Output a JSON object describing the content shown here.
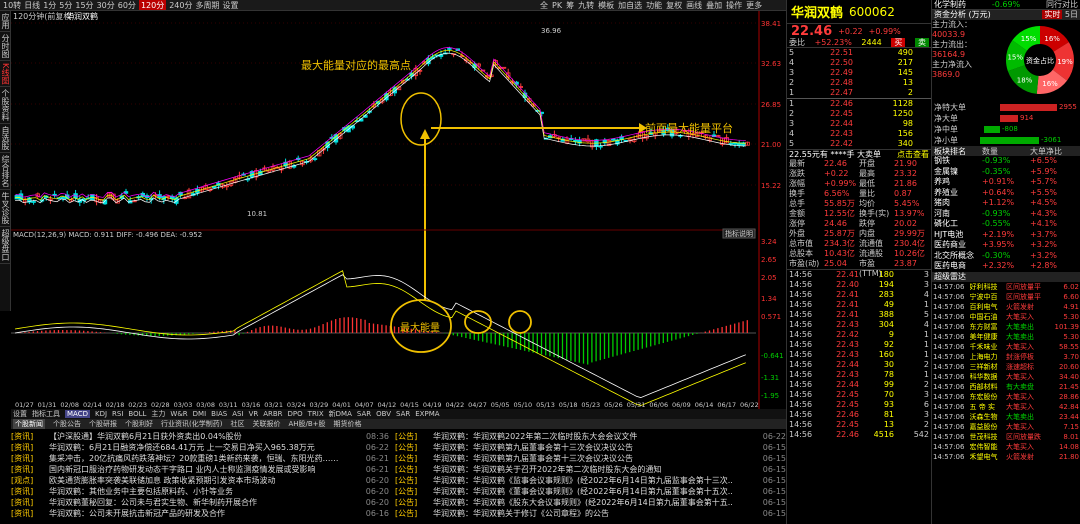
{
  "toolbar": {
    "items": [
      "10转",
      "日线",
      "1分",
      "5分",
      "15分",
      "30分",
      "60分",
      "120分",
      "240分",
      "多周期",
      "设置"
    ],
    "active": "120分",
    "tools": [
      "全",
      "PK",
      "筹",
      "九转",
      "模板",
      "加自选",
      "功能",
      "复权",
      "画线",
      "叠加",
      "操作",
      "更多"
    ]
  },
  "left_rail": [
    "应用",
    "分时图",
    "K线图",
    "个股资料",
    "自选股",
    "综合排名",
    "牛叉诊股",
    "超级盘口"
  ],
  "chart": {
    "header_period": "120分钟(前复权)",
    "header_name": "华润双鹤",
    "price_axis": [
      "38.41",
      "32.63",
      "26.85",
      "21.00",
      "15.22"
    ],
    "price_labels": {
      "high": "36.96",
      "low": "10.81"
    },
    "annotation_top": "最大能量对应的最高点",
    "annotation_right": "前面最大能量平台",
    "annotation_energy": "最大能量",
    "macd_header": "MACD(12,26,9)  MACD: 0.911  DIFF: -0.496  DEA: -0.952",
    "macd_axis": [
      "3.24",
      "2.65",
      "2.05",
      "1.34",
      "0.571",
      "-0.641",
      "-1.31",
      "-1.95"
    ],
    "help_label": "指标说明",
    "x_axis": [
      "01/27",
      "01/31",
      "02/08",
      "02/14",
      "02/18",
      "02/23",
      "02/28",
      "03/03",
      "03/08",
      "03/11",
      "03/16",
      "03/21",
      "03/24",
      "03/29",
      "04/01",
      "04/07",
      "04/12",
      "04/15",
      "04/19",
      "04/22",
      "04/27",
      "05/05",
      "05/10",
      "05/13",
      "05/18",
      "05/23",
      "05/26",
      "05/31",
      "06/06",
      "06/09",
      "06/14",
      "06/17",
      "06/22"
    ]
  },
  "indicators": [
    "设置",
    "指标工具",
    "MACD",
    "KDJ",
    "RSI",
    "BOLL",
    "主力",
    "W&R",
    "DMI",
    "BIAS",
    "ASI",
    "VR",
    "ARBR",
    "DPO",
    "TRIX",
    "新DMA",
    "SAR",
    "OBV",
    "SAR",
    "EXPMA"
  ],
  "indicator_active": "MACD",
  "news_tabs": [
    "个股新闻",
    "个股公告",
    "个股研报",
    "个股利好",
    "行业资讯(化学制药)",
    "社区",
    "关联报价",
    "AH股/B+股",
    "期货价格"
  ],
  "news_left": [
    {
      "cat": "资讯",
      "title": "【沪深股通】华润双鹤6月21日获外资卖出0.04%股份",
      "date": "08:36"
    },
    {
      "cat": "资讯",
      "title": "华润双鹤：6月21日融资净偿还684.41万元 上一交易日净买入965.38万元",
      "date": "06-22"
    },
    {
      "cat": "资讯",
      "title": "集采冲击，20亿抗痛风药跌落神坛？20款重磅1类新药来袭，恒瑞、东阳光药……",
      "date": "06-21"
    },
    {
      "cat": "资讯",
      "title": "国内新冠口服治疗药物研发动态干字路口 业内人士称监测疫情发展或受影响",
      "date": "06-21"
    },
    {
      "cat": "观点",
      "title": "欧美通货膨胀率突袭美联储加息 政策收紧预期引发资本市场波动",
      "date": "06-20"
    },
    {
      "cat": "资讯",
      "title": "华润双鹤：其他业务中主要包括原料药、小针等业务",
      "date": "06-20"
    },
    {
      "cat": "资讯",
      "title": "华润双鹤董秘回复：公司未与君实生物、新华制药开展合作",
      "date": "06-20"
    },
    {
      "cat": "资讯",
      "title": "华润双鹤：公司未开展抗击新冠产品的研发及合作",
      "date": "06-16"
    }
  ],
  "news_right": [
    {
      "cat": "公告",
      "title": "华润双鹤：华润双鹤2022年第二次临时股东大会会议文件",
      "date": "06-22"
    },
    {
      "cat": "公告",
      "title": "华润双鹤：华润双鹤第九届董事会第十三次会议决议公告",
      "date": "06-15"
    },
    {
      "cat": "公告",
      "title": "华润双鹤：华润双鹤第九届董事会第十三次会议决议公告",
      "date": "06-15"
    },
    {
      "cat": "公告",
      "title": "华润双鹤：华润双鹤关于召开2022年第二次临时股东大会的通知",
      "date": "06-15"
    },
    {
      "cat": "公告",
      "title": "华润双鹤：华润双鹤《监事会议事规则》(经2022年6月14日第九届监事会第十三次..",
      "date": "06-15"
    },
    {
      "cat": "公告",
      "title": "华润双鹤：华润双鹤《董事会议事规则》(经2022年6月14日第九届董事会第十五次..",
      "date": "06-15"
    },
    {
      "cat": "公告",
      "title": "华润双鹤：华润双鹤《股东大会议事规则》(经2022年6月14日第九届董事会第十五..",
      "date": "06-15"
    },
    {
      "cat": "公告",
      "title": "华润双鹤：华润双鹤关于修订《公司章程》的公告",
      "date": "06-15"
    }
  ],
  "quote": {
    "name": "华润双鹤",
    "code": "600062",
    "price": "22.46",
    "change": "+0.22",
    "pct": "+0.99%",
    "weibi_label": "委比",
    "weibi": "+52.23%",
    "weicha": "2444",
    "buy_btn": "买",
    "sell_btn": "卖",
    "asks": [
      {
        "lvl": "5",
        "price": "22.51",
        "vol": "490"
      },
      {
        "lvl": "4",
        "price": "22.50",
        "vol": "217"
      },
      {
        "lvl": "3",
        "price": "22.49",
        "vol": "145"
      },
      {
        "lvl": "2",
        "price": "22.48",
        "vol": "13"
      },
      {
        "lvl": "1",
        "price": "22.47",
        "vol": "2"
      }
    ],
    "bids": [
      {
        "lvl": "1",
        "price": "22.46",
        "vol": "1128"
      },
      {
        "lvl": "2",
        "price": "22.45",
        "vol": "1250"
      },
      {
        "lvl": "3",
        "price": "22.44",
        "vol": "98"
      },
      {
        "lvl": "4",
        "price": "22.43",
        "vol": "156"
      },
      {
        "lvl": "5",
        "price": "22.42",
        "vol": "340"
      }
    ],
    "bigorder": "22.55元有 ****手 大卖单",
    "bigorder_link": "点击查看",
    "stats": [
      [
        "最新",
        "22.46",
        "开盘",
        "21.90"
      ],
      [
        "涨跌",
        "+0.22",
        "最高",
        "23.32"
      ],
      [
        "涨幅",
        "+0.99%",
        "最低",
        "21.86"
      ],
      [
        "换手",
        "6.56%",
        "量比",
        "0.87"
      ],
      [
        "总手",
        "55.85万",
        "均价",
        "5.45%"
      ],
      [
        "金额",
        "12.55亿",
        "换手(实)",
        "13.97%"
      ],
      [
        "涨停",
        "24.46",
        "跌停",
        "20.02"
      ],
      [
        "外盘",
        "25.87万",
        "内盘",
        "29.99万"
      ],
      [
        "总市值",
        "234.3亿",
        "流通值",
        "230.4亿"
      ],
      [
        "总股本",
        "10.43亿",
        "流通股",
        "10.26亿"
      ],
      [
        "市盈(动)",
        "25.04",
        "市盈(TTM)",
        "23.87"
      ]
    ],
    "ticks": [
      [
        "14:56",
        "22.41",
        "180",
        "3"
      ],
      [
        "14:56",
        "22.40",
        "194",
        "3"
      ],
      [
        "14:56",
        "22.41",
        "283",
        "4"
      ],
      [
        "14:56",
        "22.41",
        "49",
        "1"
      ],
      [
        "14:56",
        "22.41",
        "388",
        "5"
      ],
      [
        "14:56",
        "22.43",
        "304",
        "4"
      ],
      [
        "14:56",
        "22.42",
        "9",
        "1"
      ],
      [
        "14:56",
        "22.43",
        "92",
        "1"
      ],
      [
        "14:56",
        "22.43",
        "160",
        "1"
      ],
      [
        "14:56",
        "22.44",
        "30",
        "2"
      ],
      [
        "14:56",
        "22.43",
        "78",
        "1"
      ],
      [
        "14:56",
        "22.44",
        "99",
        "2"
      ],
      [
        "14:56",
        "22.45",
        "70",
        "3"
      ],
      [
        "14:56",
        "22.45",
        "93",
        "6"
      ],
      [
        "14:56",
        "22.46",
        "81",
        "3"
      ],
      [
        "14:56",
        "22.45",
        "13",
        "2"
      ],
      [
        "14:56",
        "22.46",
        "4516",
        "542"
      ]
    ]
  },
  "far_right": {
    "industry": "化学制药",
    "industry_pct": "-0.69%",
    "industry_link": "同行对比",
    "fund_title": "资金分析 (万元)",
    "fund_tabs": [
      "实时",
      "5日"
    ],
    "fund": [
      {
        "label": "主力流入：",
        "val": "40033.9"
      },
      {
        "label": "主力流出：",
        "val": "36164.9"
      },
      {
        "label": "主力净流入",
        "val": "3869.0"
      }
    ],
    "pie_center": "资金占比",
    "pie_labels": [
      "16%",
      "19%",
      "16%",
      "18%",
      "15%",
      "15%"
    ],
    "flows": [
      {
        "label": "净特大单",
        "val": "2955",
        "color": "red"
      },
      {
        "label": "净大单",
        "val": "914",
        "color": "red"
      },
      {
        "label": "净中单",
        "val": "-808",
        "color": "green"
      },
      {
        "label": "净小单",
        "val": "-3061",
        "color": "green"
      }
    ],
    "sector_tabs": [
      "板块排名",
      "数量",
      "大单净比"
    ],
    "sectors": [
      [
        "钢铁",
        "-0.93%",
        "+6.5%"
      ],
      [
        "金属镍",
        "-0.35%",
        "+5.9%"
      ],
      [
        "养鸡",
        "+0.91%",
        "+5.7%"
      ],
      [
        "养殖业",
        "+0.64%",
        "+5.5%"
      ],
      [
        "猪肉",
        "+1.12%",
        "+4.5%"
      ],
      [
        "河南",
        "-0.93%",
        "+4.3%"
      ],
      [
        "磷化工",
        "-0.55%",
        "+4.1%"
      ],
      [
        "HJT电池",
        "+2.19%",
        "+3.7%"
      ],
      [
        "医药商业",
        "+3.95%",
        "+3.2%"
      ],
      [
        "北交所概念",
        "-0.30%",
        "+3.2%"
      ],
      [
        "医药电商",
        "+2.32%",
        "+2.8%"
      ]
    ],
    "bt_title": "超级雷达",
    "bt": [
      [
        "14:57:06",
        "好利科技",
        "区间放量平",
        "6.02"
      ],
      [
        "14:57:06",
        "宁波中百",
        "区间放量平",
        "6.60"
      ],
      [
        "14:57:06",
        "百利电气",
        "火箭发射",
        "4.91"
      ],
      [
        "14:57:06",
        "中国石油",
        "大笔买入",
        "5.30"
      ],
      [
        "14:57:06",
        "东方财富",
        "大笔卖出",
        "101.39"
      ],
      [
        "14:57:06",
        "美年健康",
        "大笔卖出",
        "5.30"
      ],
      [
        "14:57:06",
        "千禾味业",
        "大笔买入",
        "58.55"
      ],
      [
        "14:57:06",
        "上海电力",
        "封涨停板",
        "3.70"
      ],
      [
        "14:57:06",
        "三祥新材",
        "涨速超标",
        "20.60"
      ],
      [
        "14:57:06",
        "科华数据",
        "大笔买入",
        "34.40"
      ],
      [
        "14:57:06",
        "西部材料",
        "有大卖盘",
        "21.45"
      ],
      [
        "14:57:06",
        "东宏股份",
        "大笔买入",
        "28.86"
      ],
      [
        "14:57:06",
        "五 帝 实",
        "大笔买入",
        "42.84"
      ],
      [
        "14:57:06",
        "沃森生物",
        "大笔卖出",
        "23.44"
      ],
      [
        "14:57:06",
        "嘉益股份",
        "大笔买入",
        "7.15"
      ],
      [
        "14:57:06",
        "世茂科技",
        "区间放量跌",
        "8.01"
      ],
      [
        "14:57:06",
        "宏伟智能",
        "大笔买入",
        "14.08"
      ],
      [
        "14:57:06",
        "禾望电气",
        "火箭发射",
        "21.80"
      ]
    ]
  }
}
